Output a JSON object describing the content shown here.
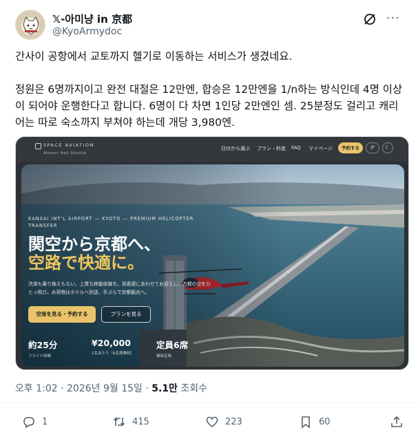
{
  "author": {
    "display_name": "𝕏-아미냥 in 京都",
    "handle": "@KyoArmydoc"
  },
  "post": {
    "paragraph1": "간사이 공항에서 교토까지 헬기로 이동하는 서비스가 생겼네요.",
    "paragraph2": "정원은 6명까지이고 완전 대절은 12만엔, 합승은 12만엔을 1/n하는 방식인데 4명 이상이 되어야 운행한다고 합니다. 6명이 다 차면 1인당 2만엔인 셈. 25분정도 걸리고 캐리어는 따로 숙소까지 부쳐야 하는데 개당 3,980엔."
  },
  "embedded_site": {
    "brand": "SPACE AVIATION",
    "brand_sub": "Airport Heli Shuttle",
    "nav": [
      "日付から選ぶ",
      "プラン・料金",
      "FAQ",
      "マイページ"
    ],
    "book_button": "予約する",
    "lang_button": "JP",
    "theme_icon": "moon-icon",
    "eyebrow": "KANSAI INT'L AIRPORT — KYOTO — PREMIUM HELICOPTER TRANSFER",
    "headline_line1": "関空から京都へ、",
    "headline_line2": "空路で快適に。",
    "description": "渋滞も乗り換えもない、上質な移動体験を。到着便にあわせてお迎えし、古都の空をひとっ飛び。お荷物はホテルへ別送、手ぶらで京都観光へ。",
    "cta_primary": "空席を見る・予約する",
    "cta_secondary": "プランを見る",
    "stats": [
      {
        "value": "約25分",
        "label": "フライト時間"
      },
      {
        "value": "¥20,000",
        "label": "1名あたり（6名搭乗時）"
      },
      {
        "value": "定員6席",
        "label": "機体定員"
      }
    ]
  },
  "meta": {
    "time_date": "오후 1:02 · 2026년 9월 15일 · ",
    "views_count": "5.1만",
    "views_label": " 조회수"
  },
  "actions": {
    "replies": "1",
    "reposts": "415",
    "likes": "223",
    "bookmarks": "60"
  },
  "colors": {
    "text_primary": "#0f1419",
    "text_secondary": "#536471",
    "accent_gold": "#e9c46a",
    "site_nav_bg": "#34383d"
  }
}
